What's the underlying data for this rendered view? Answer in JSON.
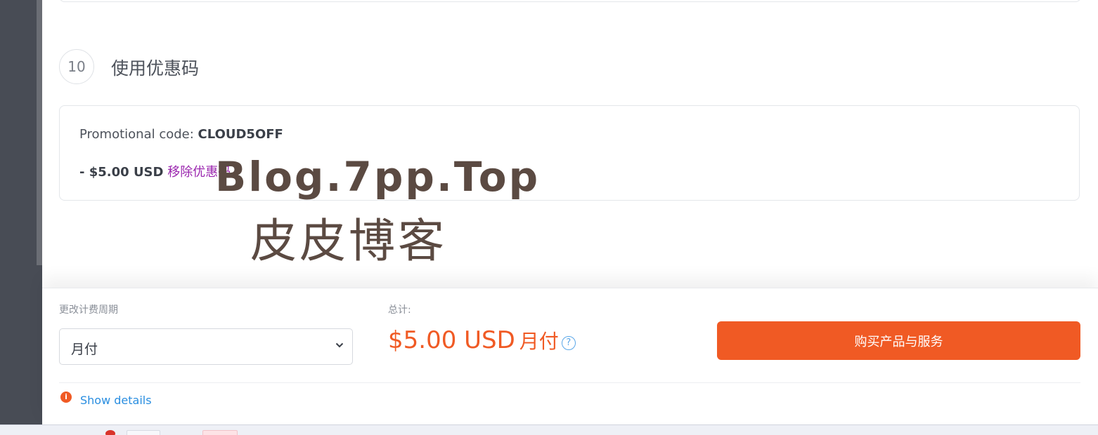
{
  "step": {
    "number": "10",
    "title": "使用优惠码"
  },
  "promo": {
    "label": "Promotional code: ",
    "code": "CLOUD5OFF",
    "discount": "- $5.00 USD",
    "remove_label": "移除优惠码"
  },
  "watermark": {
    "line1": "Blog.7pp.Top",
    "line2": "皮皮博客"
  },
  "checkout": {
    "cycle_label": "更改计费周期",
    "cycle_selected": "月付",
    "total_label": "总计:",
    "total_amount": "$5.00 USD",
    "total_cycle": "月付",
    "help_icon": "?",
    "buy_label": "购买产品与服务",
    "info_icon": "i",
    "show_details": "Show details"
  },
  "colors": {
    "accent": "#f05a24",
    "link": "#2a8ee0",
    "remove_link": "#9b27af",
    "sidebar": "#484c55"
  }
}
